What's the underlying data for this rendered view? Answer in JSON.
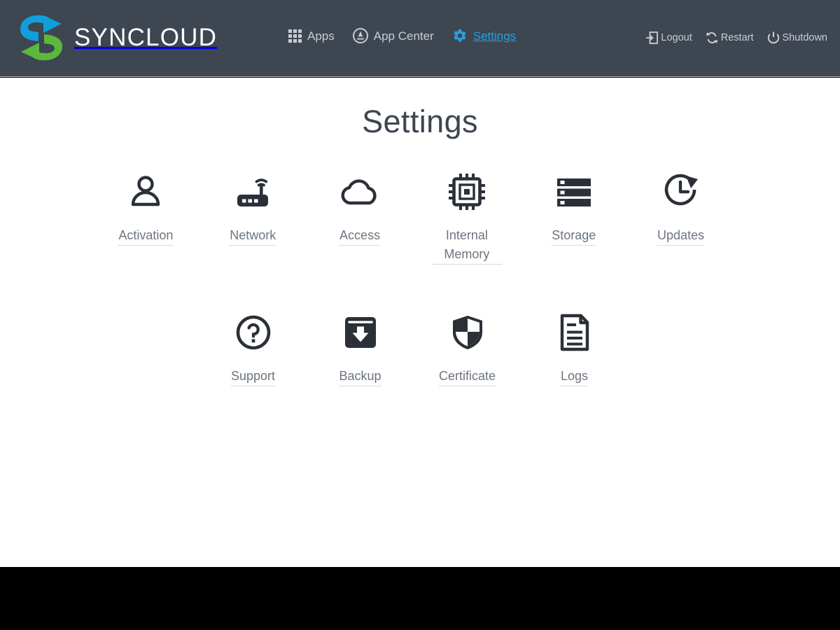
{
  "header": {
    "brand_name": "SYNCLOUD",
    "logo_icon": "syncloud-circular-arrows-logo",
    "logo_colors": {
      "blue": "#109fda",
      "green": "#5cb83c"
    },
    "background_color": "#3e4651",
    "nav": [
      {
        "label": "Apps",
        "icon": "grid-apps-icon",
        "active": false
      },
      {
        "label": "App Center",
        "icon": "app-center-circle-a-icon",
        "active": false
      },
      {
        "label": "Settings",
        "icon": "gear-icon",
        "active": true,
        "accent_color": "#2a9fd8"
      }
    ],
    "system_actions": [
      {
        "label": "Logout",
        "icon": "logout-arrow-icon"
      },
      {
        "label": "Restart",
        "icon": "restart-circular-arrows-icon"
      },
      {
        "label": "Shutdown",
        "icon": "power-icon"
      }
    ]
  },
  "main": {
    "title": "Settings",
    "tiles_row1": [
      {
        "label": "Activation",
        "icon": "person-icon"
      },
      {
        "label": "Network",
        "icon": "wifi-router-icon"
      },
      {
        "label": "Access",
        "icon": "cloud-icon"
      },
      {
        "label": "Internal Memory",
        "icon": "cpu-chip-icon"
      },
      {
        "label": "Storage",
        "icon": "server-stack-icon"
      },
      {
        "label": "Updates",
        "icon": "clock-refresh-icon"
      }
    ],
    "tiles_row2": [
      {
        "label": "Support",
        "icon": "question-circle-icon"
      },
      {
        "label": "Backup",
        "icon": "archive-download-icon"
      },
      {
        "label": "Certificate",
        "icon": "shield-icon"
      },
      {
        "label": "Logs",
        "icon": "document-lines-icon"
      }
    ]
  },
  "colors": {
    "header_bg": "#3e4651",
    "content_bg": "#ffffff",
    "footer_bg": "#000000",
    "title_text": "#3d4550",
    "label_text": "#6d757f",
    "icon_dark": "#2b3038",
    "link_blue": "#2a9fd8"
  }
}
